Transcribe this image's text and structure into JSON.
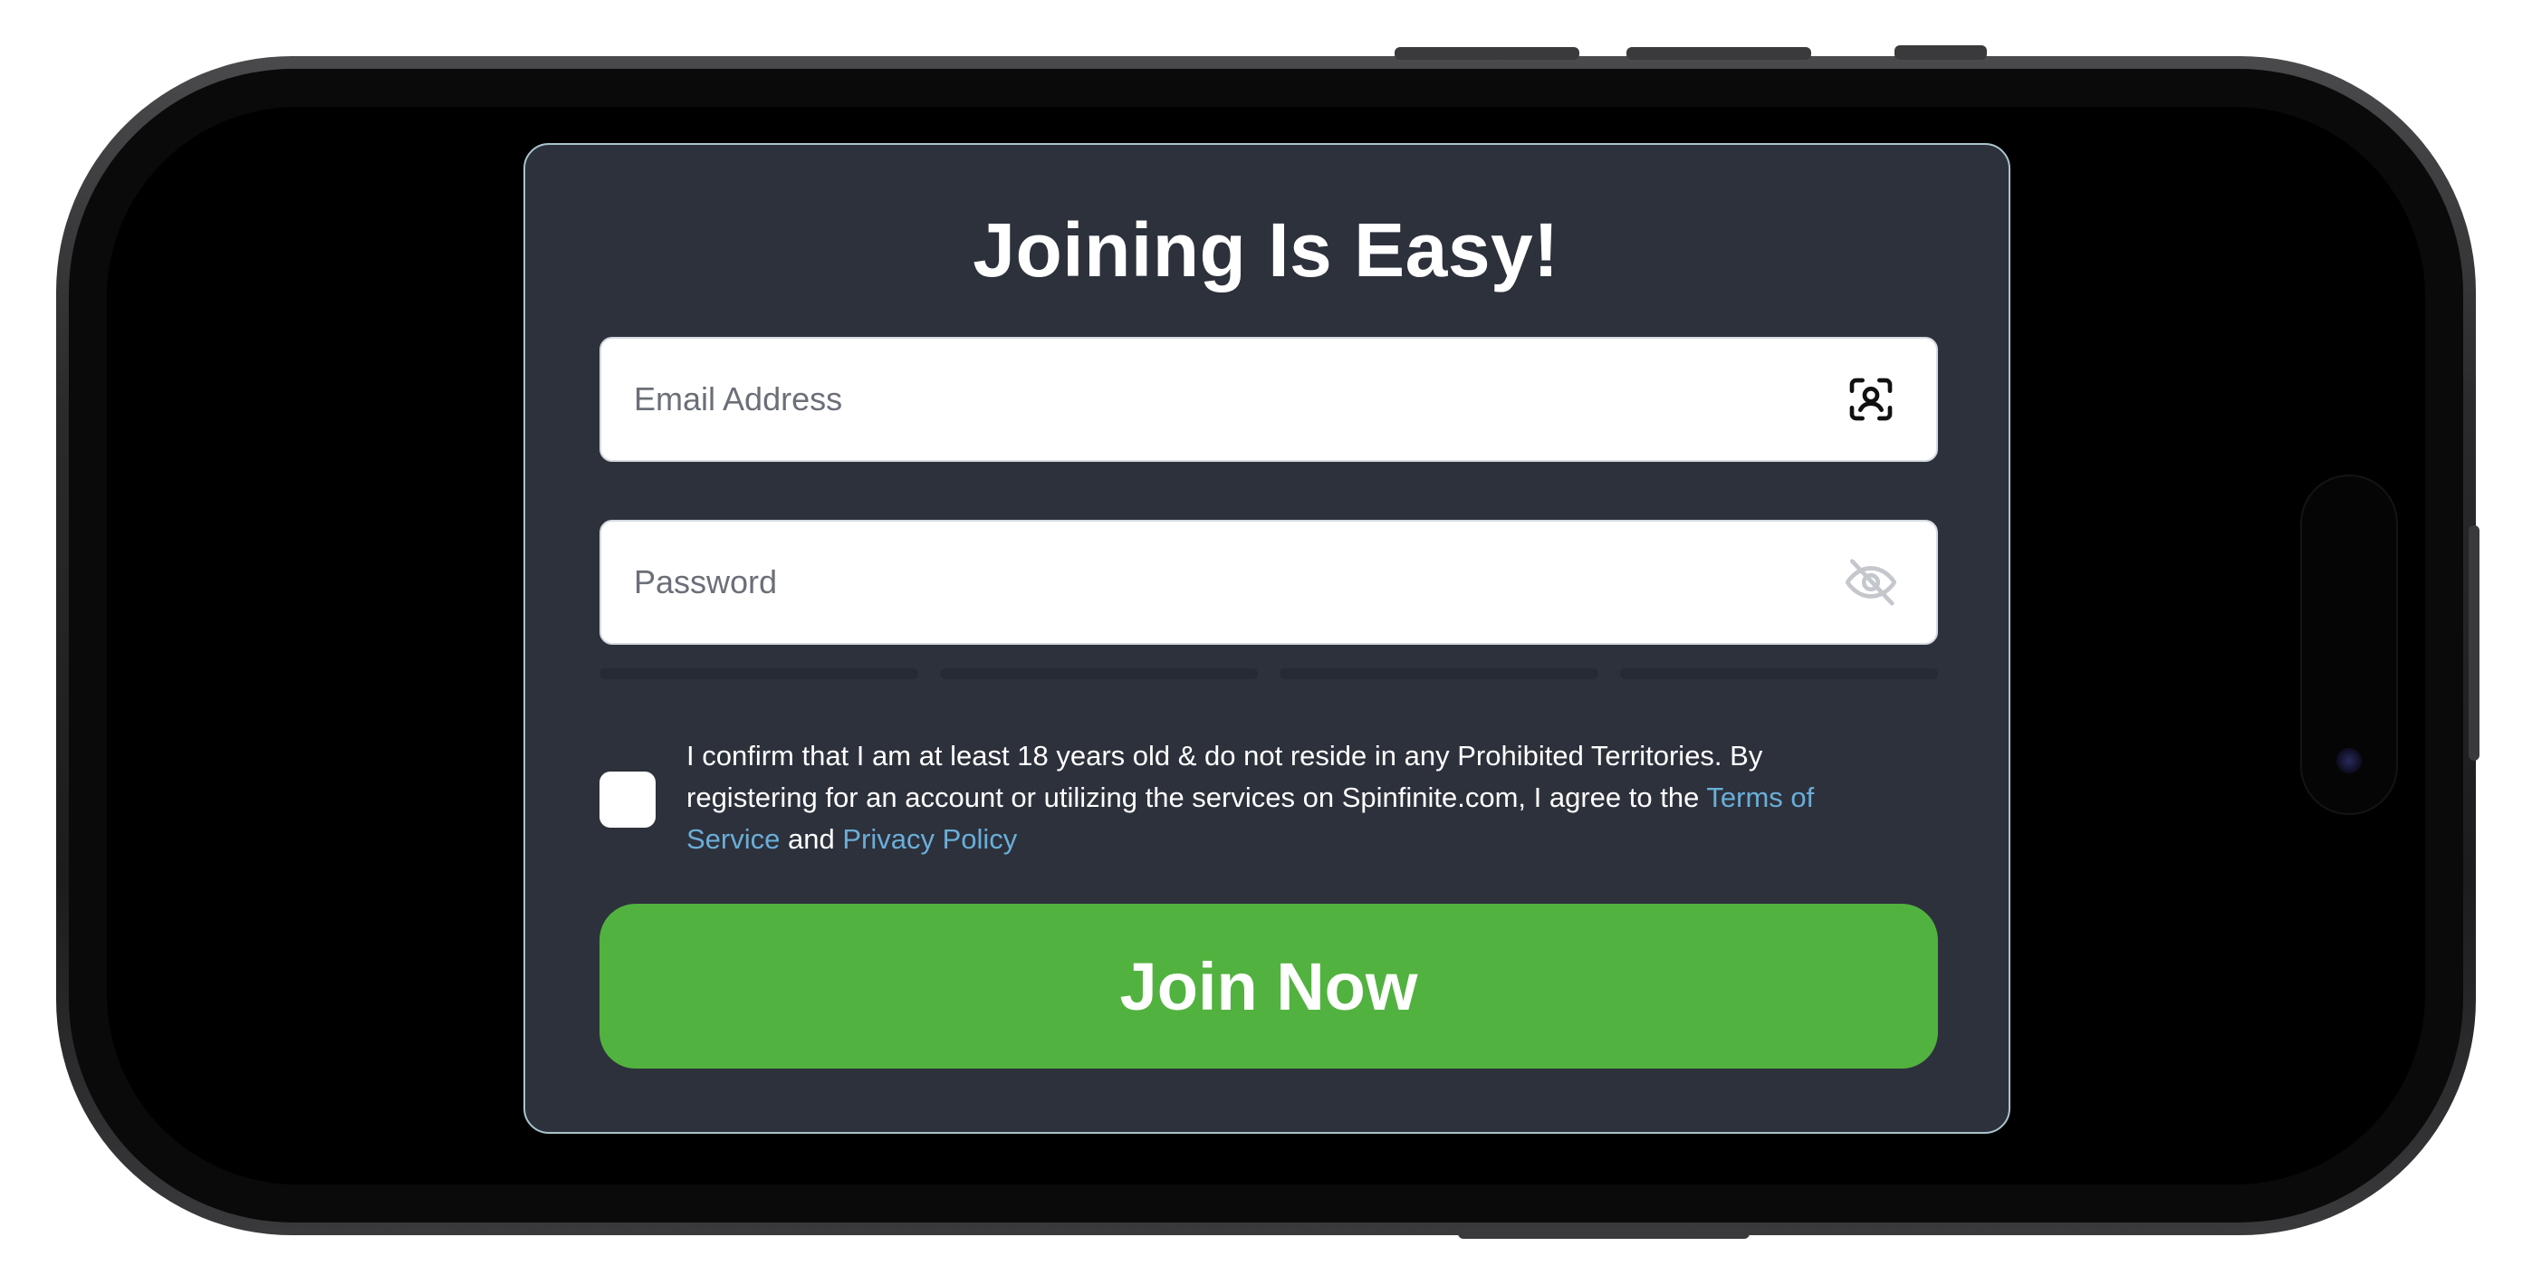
{
  "form": {
    "title": "Joining Is Easy!",
    "email_placeholder": "Email Address",
    "password_placeholder": "Password",
    "email_icon": "face-id-icon",
    "password_icon": "eye-off-icon",
    "consent": {
      "text_before": "I confirm that I am at least 18 years old & do not reside in any Prohibited Territories. By registering for an account or utilizing the services on Spinfinite.com, I agree to the ",
      "terms_link": "Terms of Service",
      "text_between": " and ",
      "privacy_link": "Privacy Policy"
    },
    "submit_label": "Join Now"
  },
  "colors": {
    "card_background": "#2d313c",
    "card_border": "#a9c4cc",
    "button_green": "#52b23f",
    "link_blue": "#6aaed8"
  }
}
